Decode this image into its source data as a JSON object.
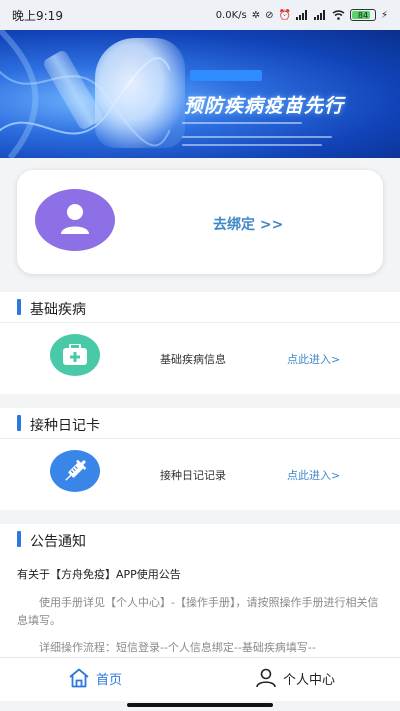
{
  "status_bar": {
    "time": "晚上9:19",
    "net_speed": "0.0K/s",
    "battery": "84",
    "battery_level": 0.84,
    "icons": [
      "bluetooth-icon",
      "mute-icon",
      "alarm-icon",
      "signal-icon",
      "signal-icon",
      "wifi-icon",
      "battery-icon",
      "charging-icon"
    ]
  },
  "banner": {
    "title": "预防疾病疫苗先行"
  },
  "bind_card": {
    "link_label": "去绑定 >>",
    "avatar_icon": "user-avatar-icon",
    "avatar_color": "#8e70e6"
  },
  "sections": {
    "disease": {
      "title": "基础疾病",
      "item_label": "基础疾病信息",
      "link_label": "点此进入>",
      "icon": "medical-kit-icon",
      "icon_color": "#49c9a8"
    },
    "vaccine": {
      "title": "接种日记卡",
      "item_label": "接种日记记录",
      "link_label": "点此进入>",
      "icon": "syringe-icon",
      "icon_color": "#3a86e8"
    }
  },
  "notice": {
    "title": "公告通知",
    "item_title": "有关于【方舟免疫】APP使用公告",
    "paragraph1": "使用手册详见【个人中心】-【操作手册】，请按照操作手册进行相关信息填写。",
    "paragraph2": "详细操作流程：短信登录--个人信息绑定--基础疾病填写--"
  },
  "tabs": {
    "home": "首页",
    "profile": "个人中心",
    "home_icon": "home-icon",
    "profile_icon": "person-icon"
  },
  "colors": {
    "accent": "#2f77e0",
    "link": "#3f88c8"
  }
}
